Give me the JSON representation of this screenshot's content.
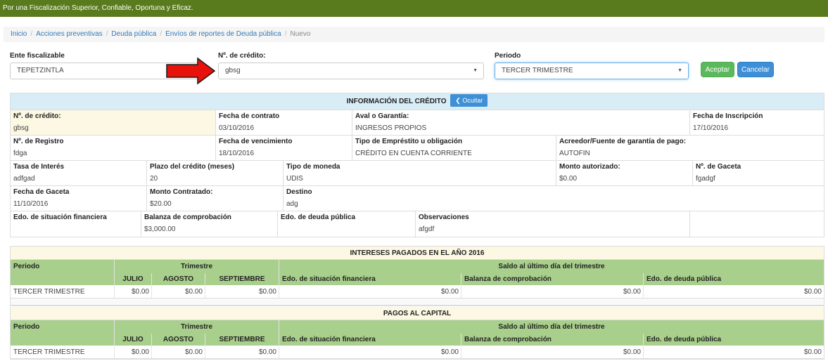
{
  "topbar": {
    "slogan": "Por una Fiscalización Superior, Confiable, Oportuna y Eficaz."
  },
  "breadcrumb": {
    "items": [
      "Inicio",
      "Acciones preventivas",
      "Deuda pública",
      "Envíos de reportes de Deuda pública"
    ],
    "current": "Nuevo",
    "separator": "/"
  },
  "form": {
    "ente_label": "Ente fiscalizable",
    "ente_value": "TEPETZINTLA",
    "credito_label": "Nº. de crédito:",
    "credito_value": "gbsg",
    "periodo_label": "Periodo",
    "periodo_value": "TERCER TRIMESTRE",
    "accept_label": "Aceptar",
    "cancel_label": "Cancelar"
  },
  "info": {
    "title": "INFORMACIÓN DEL CRÉDITO",
    "hide_label": "Ocultar",
    "rows": [
      [
        {
          "label": "Nº. de crédito:",
          "value": "gbsg"
        },
        {
          "label": "Fecha de contrato",
          "value": "03/10/2016"
        },
        {
          "label": "Aval o Garantía:",
          "value": "INGRESOS PROPIOS"
        },
        {
          "label": "Fecha de Inscripción",
          "value": "17/10/2016"
        }
      ],
      [
        {
          "label": "Nº. de Registro",
          "value": "fdga"
        },
        {
          "label": "Fecha de vencimiento",
          "value": "18/10/2016"
        },
        {
          "label": "Tipo de Empréstito u obligación",
          "value": "CRÉDITO EN CUENTA CORRIENTE"
        },
        {
          "label": "Acreedor/Fuente de garantía de pago:",
          "value": "AUTOFIN"
        }
      ],
      [
        {
          "label": "Tasa de Interés",
          "value": "adfgad"
        },
        {
          "label": "Plazo del crédito (meses)",
          "value": "20"
        },
        {
          "label": "Tipo de moneda",
          "value": "UDIS"
        },
        {
          "label": "Monto autorizado:",
          "value": "$0.00"
        },
        {
          "label": "Nº. de Gaceta",
          "value": "fgadgf"
        }
      ],
      [
        {
          "label": "Fecha de Gaceta",
          "value": "11/10/2016"
        },
        {
          "label": "Monto Contratado:",
          "value": "$20.00"
        },
        {
          "label": "Destino",
          "value": "adg"
        }
      ],
      [
        {
          "label": "Edo. de situación financiera",
          "value": ""
        },
        {
          "label": "Balanza de comprobación",
          "value": "$3,000.00"
        },
        {
          "label": "Edo. de deuda pública",
          "value": ""
        },
        {
          "label": "Observaciones",
          "value": "afgdf"
        },
        {
          "label": "",
          "value": ""
        }
      ]
    ]
  },
  "tables": [
    {
      "title": "INTERESES PAGADOS EN EL AÑO 2016",
      "h_periodo": "Periodo",
      "h_trimestre": "Trimestre",
      "h_saldo": "Saldo al último día del trimestre",
      "months": [
        "JULIO",
        "AGOSTO",
        "SEPTIEMBRE"
      ],
      "h_edo_sit": "Edo. de situación financiera",
      "h_balanza": "Balanza de comprobación",
      "h_edo_deuda": "Edo. de deuda pública",
      "row": {
        "periodo": "TERCER TRIMESTRE",
        "julio": "$0.00",
        "agosto": "$0.00",
        "septiembre": "$0.00",
        "edo_sit": "$0.00",
        "balanza": "$0.00",
        "edo_deuda": "$0.00"
      }
    },
    {
      "title": "PAGOS AL CAPITAL",
      "h_periodo": "Periodo",
      "h_trimestre": "Trimestre",
      "h_saldo": "Saldo al último día del trimestre",
      "months": [
        "JULIO",
        "AGOSTO",
        "SEPTIEMBRE"
      ],
      "h_edo_sit": "Edo. de situación financiera",
      "h_balanza": "Balanza de comprobación",
      "h_edo_deuda": "Edo. de deuda pública",
      "row": {
        "periodo": "TERCER TRIMESTRE",
        "julio": "$0.00",
        "agosto": "$0.00",
        "septiembre": "$0.00",
        "edo_sit": "$0.00",
        "balanza": "$0.00",
        "edo_deuda": "$0.00"
      }
    }
  ],
  "colors": {
    "topbar": "#5a7a1e",
    "accent_blue": "#3e8fd6",
    "accept_green": "#5cb85c",
    "header_green": "#a9cf8c",
    "info_blue": "#d9edf7",
    "title_yellow": "#fcf8e3",
    "arrow_red": "#e8120c"
  }
}
